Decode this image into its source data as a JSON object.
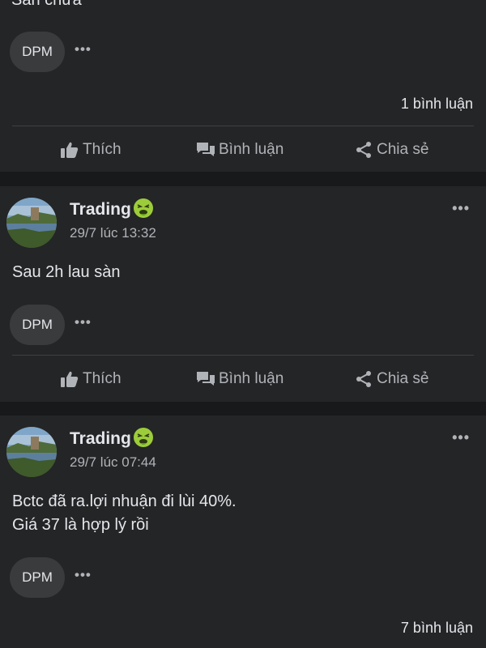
{
  "top_post": {
    "cut_text": "Sàn chưa",
    "tag": "DPM",
    "more": "•••",
    "comment_count": "1 bình luận"
  },
  "actions": {
    "like": "Thích",
    "comment": "Bình luận",
    "share": "Chia sẻ"
  },
  "posts": [
    {
      "author": "Trading",
      "timestamp": "29/7 lúc 13:32",
      "body": "Sau 2h lau sàn",
      "tag": "DPM",
      "more": "•••"
    },
    {
      "author": "Trading",
      "timestamp": "29/7 lúc 07:44",
      "body": "Bctc đã ra.lợi nhuận đi lùi 40%.\nGiá 37 là hợp lý rồi",
      "tag": "DPM",
      "more": "•••",
      "comment_count": "7 bình luận"
    }
  ],
  "icons": {
    "author_emoji": "nauseated-face-icon",
    "like": "thumbs-up-icon",
    "comment": "chat-bubbles-icon",
    "share": "share-icon",
    "more": "more-dots-icon"
  },
  "colors": {
    "background": "#18191a",
    "card": "#242526",
    "text": "#e4e6eb",
    "muted": "#b0b3b8",
    "pill": "#3a3b3c"
  }
}
